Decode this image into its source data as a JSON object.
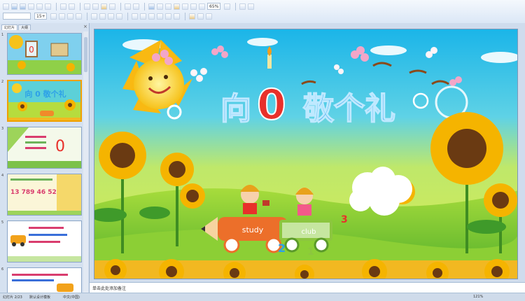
{
  "toolbar": {
    "font_size": "15+",
    "zoom": "65%"
  },
  "left_pane": {
    "tab_slides": "幻灯片",
    "tab_outline": "大纲",
    "close_symbol": "×",
    "thumb_numbers": [
      "1",
      "2",
      "3",
      "4",
      "5",
      "6"
    ]
  },
  "slide": {
    "title_1": "向",
    "title_digit": "0",
    "title_2": "敬个礼",
    "tag_study": "study",
    "tag_club": "club",
    "num_2": "2",
    "num_1": "1",
    "num_3": "3"
  },
  "thumbs_text": {
    "t2_title": "向 0 敬个礼",
    "t4_nums": "13  789  46  52"
  },
  "notes": {
    "placeholder": "单击此处添加备注"
  },
  "status": {
    "left": "幻灯片 2/23",
    "theme": "默认设计模板",
    "lang": "中文(中国)",
    "zoom": "121%"
  },
  "colors": {
    "sky": "#34c6e8",
    "grass": "#9ad23a",
    "title": "#2da0e8",
    "zero": "#e8302a"
  }
}
